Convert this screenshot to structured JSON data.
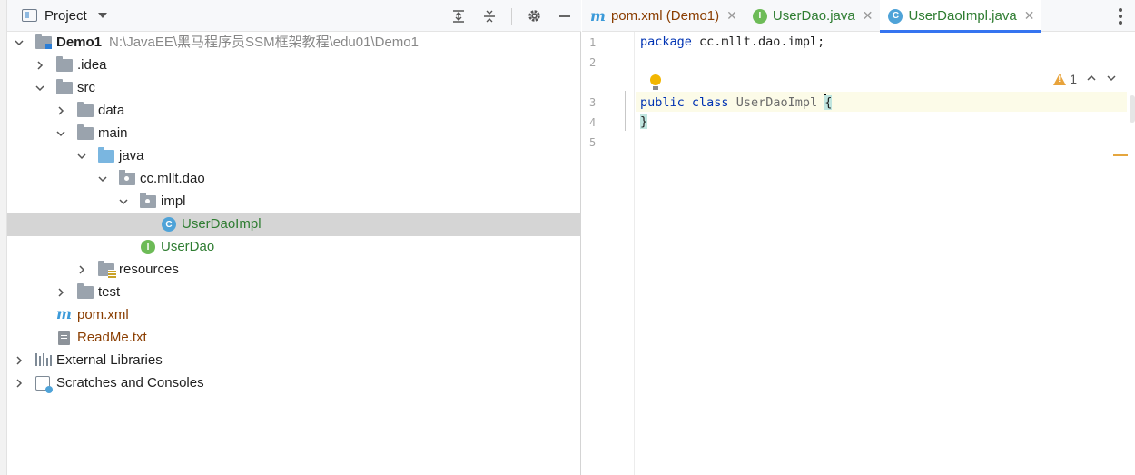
{
  "project_panel": {
    "title": "Project",
    "tree": [
      {
        "label": "Demo1",
        "path": "N:\\JavaEE\\黑马程序员SSM框架教程\\edu01\\Demo1"
      },
      {
        "label": ".idea"
      },
      {
        "label": "src"
      },
      {
        "label": "data"
      },
      {
        "label": "main"
      },
      {
        "label": "java"
      },
      {
        "label": "cc.mllt.dao"
      },
      {
        "label": "impl"
      },
      {
        "label": "UserDaoImpl",
        "icon_letter": "C"
      },
      {
        "label": "UserDao",
        "icon_letter": "I"
      },
      {
        "label": "resources"
      },
      {
        "label": "test"
      },
      {
        "label": "pom.xml",
        "icon_letter": "m"
      },
      {
        "label": "ReadMe.txt"
      },
      {
        "label": "External Libraries"
      },
      {
        "label": "Scratches and Consoles"
      }
    ]
  },
  "editor": {
    "tabs": [
      {
        "icon_letter": "m",
        "label": "pom.xml (Demo1)",
        "close": "✕"
      },
      {
        "icon_letter": "I",
        "label": "UserDao.java",
        "close": "✕"
      },
      {
        "icon_letter": "C",
        "label": "UserDaoImpl.java",
        "close": "✕"
      }
    ],
    "line_numbers": [
      "1",
      "2",
      "3",
      "4",
      "5"
    ],
    "code": {
      "l1_kw": "package",
      "l1_rest": " cc.mllt.dao.impl;",
      "l3_kw1": "public",
      "l3_kw2": " class",
      "l3_name": " UserDaoImpl ",
      "l3_brace": "{",
      "l4_brace": "}"
    },
    "inspections": {
      "warning_count": "1"
    }
  },
  "colors": {
    "keyword": "#0033b3",
    "selected_row": "#d5d5d5",
    "active_tab_underline": "#3574f0",
    "warning": "#e8a33b"
  }
}
